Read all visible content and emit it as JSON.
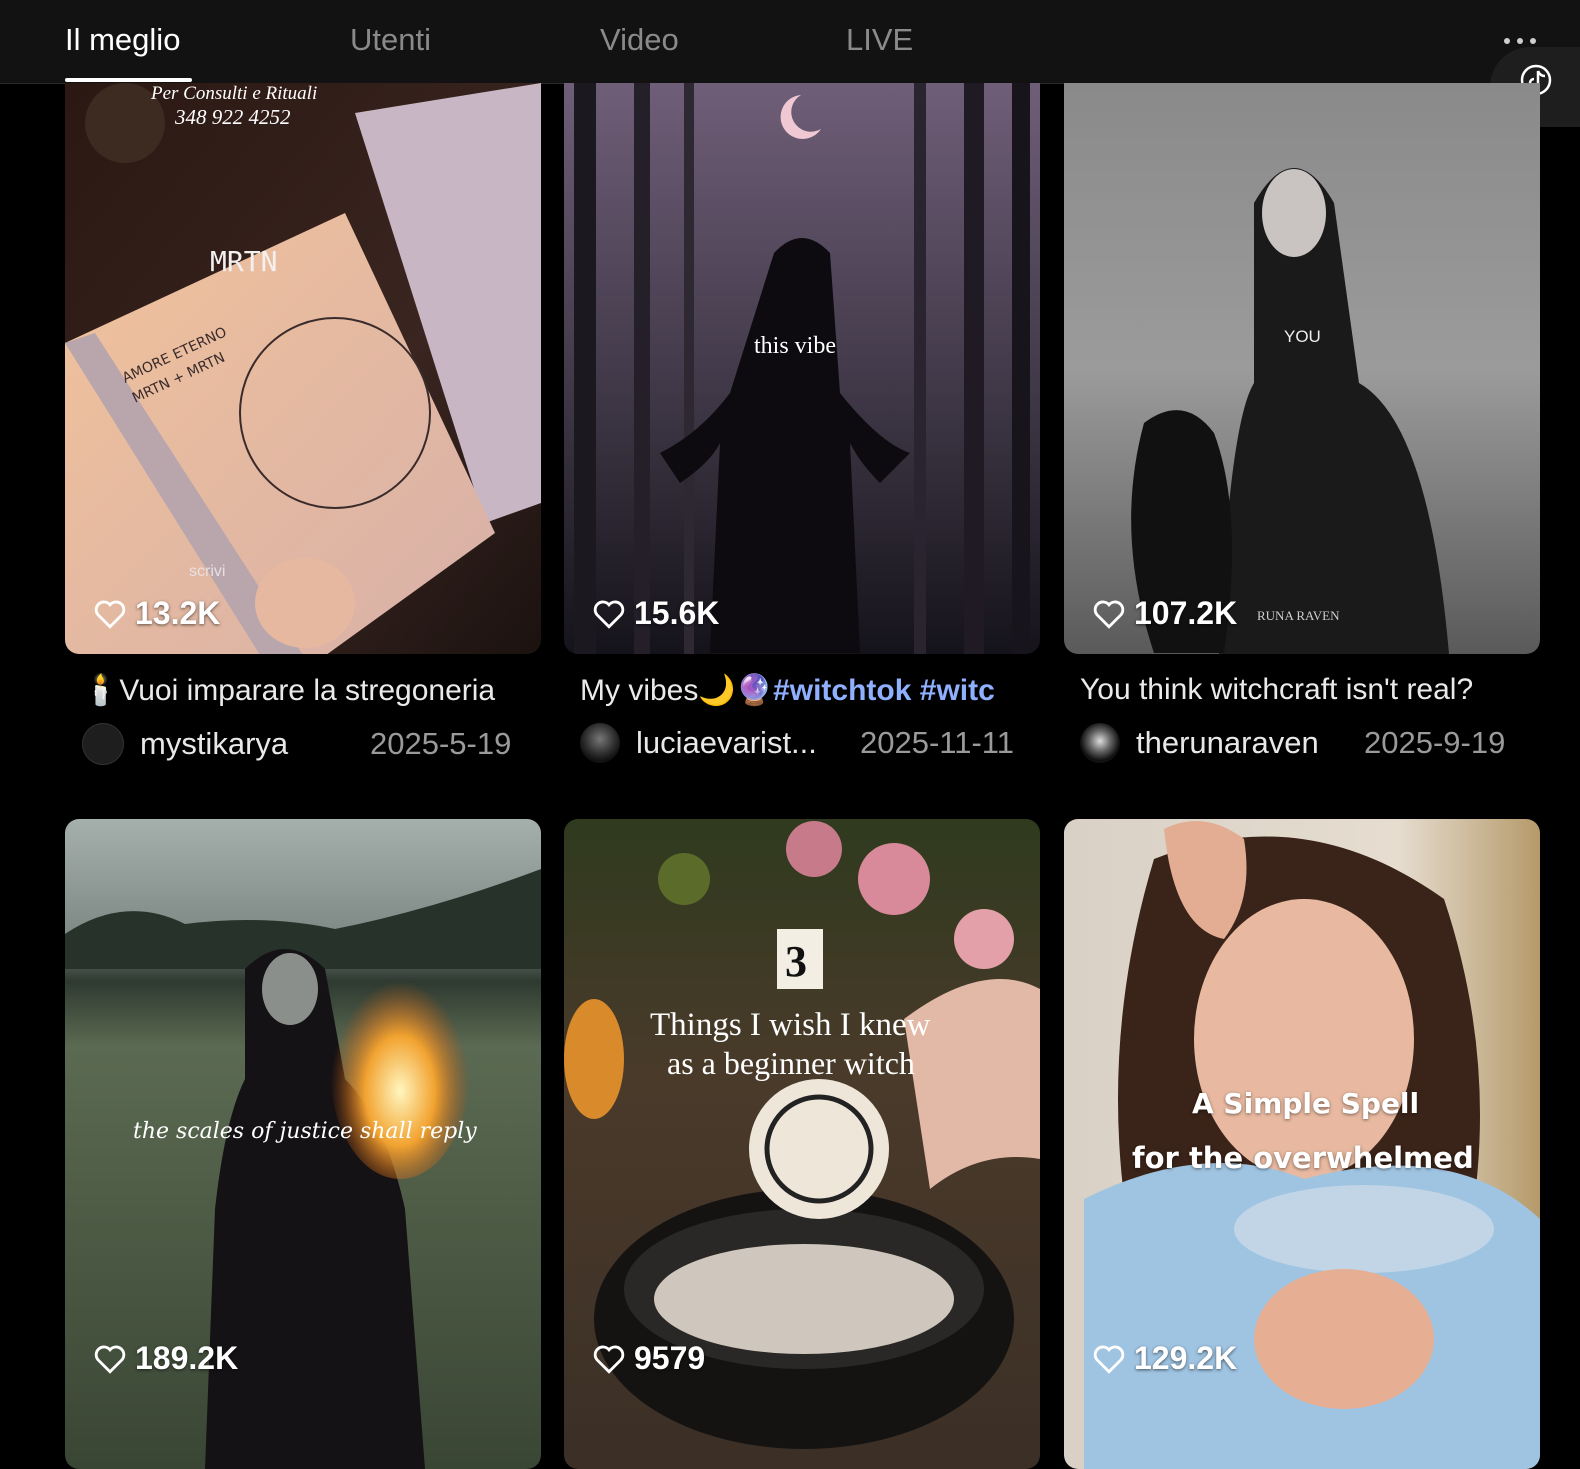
{
  "tabs": [
    {
      "label": "Il meglio",
      "active": true
    },
    {
      "label": "Utenti",
      "active": false
    },
    {
      "label": "Video",
      "active": false
    },
    {
      "label": "LIVE",
      "active": false
    }
  ],
  "icons": {
    "more": "more-dots-icon",
    "floating": "tiktok-note-icon",
    "like": "heart-outline-icon"
  },
  "cards": [
    {
      "likes": "13.2K",
      "overlay_lines": [
        "Per Consulti e Rituali",
        "348 922 4252",
        "MRTN",
        "scrivi"
      ],
      "caption": "🕯️Vuoi imparare la stregoneria",
      "user": "mystikarya",
      "date": "2025-5-19"
    },
    {
      "likes": "15.6K",
      "overlay_lines": [
        "this vibe"
      ],
      "caption": "My vibes🌙🔮",
      "caption_tags": "#witchtok #witc",
      "user": "luciaevarist...",
      "date": "2025-11-11"
    },
    {
      "likes": "107.2K",
      "overlay_lines": [
        "YOU",
        "RUNA RAVEN"
      ],
      "caption": "You think witchcraft isn't real?",
      "user": "therunaraven",
      "date": "2025-9-19"
    },
    {
      "likes": "189.2K",
      "overlay_lines": [
        "the scales of justice shall reply"
      ]
    },
    {
      "likes": "9579",
      "overlay_lines": [
        "3",
        "Things I wish I knew",
        "as a beginner witch"
      ]
    },
    {
      "likes": "129.2K",
      "overlay_lines": [
        "A Simple Spell",
        "for the overwhelmed"
      ]
    }
  ],
  "colors": {
    "background": "#000000",
    "topbar": "#121212",
    "tab_inactive": "#8a8a8a",
    "hashtag": "#8fb0ff",
    "date": "#9a9a9a"
  }
}
